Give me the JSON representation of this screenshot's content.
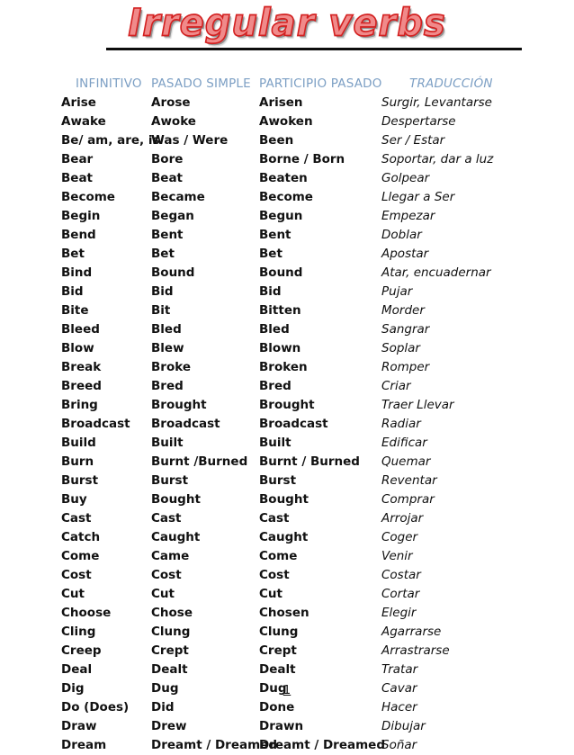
{
  "document": {
    "title": "Irregular verbs",
    "page_number": "1",
    "title_fill_color": "#F08A8A",
    "title_outline_color": "#D32020",
    "header_color": "#7C9FC4"
  },
  "table": {
    "headers": {
      "infinitive": "INFINITIVO",
      "past_simple": "PASADO SIMPLE",
      "past_participle": "PARTICIPIO PASADO",
      "translation": "TRADUCCIÓN"
    },
    "rows": [
      {
        "infinitive": "Arise",
        "past_simple": "Arose",
        "past_participle": "Arisen",
        "translation": "Surgir, Levantarse"
      },
      {
        "infinitive": "Awake",
        "past_simple": "Awoke",
        "past_participle": "Awoken",
        "translation": "Despertarse"
      },
      {
        "infinitive": "Be/ am, are, is",
        "past_simple": "Was / Were",
        "past_participle": "Been",
        "translation": "Ser / Estar"
      },
      {
        "infinitive": "Bear",
        "past_simple": "Bore",
        "past_participle": "Borne / Born",
        "translation": "Soportar, dar a luz"
      },
      {
        "infinitive": "Beat",
        "past_simple": "Beat",
        "past_participle": "Beaten",
        "translation": "Golpear"
      },
      {
        "infinitive": "Become",
        "past_simple": "Became",
        "past_participle": "Become",
        "translation": "Llegar a Ser"
      },
      {
        "infinitive": "Begin",
        "past_simple": "Began",
        "past_participle": "Begun",
        "translation": "Empezar"
      },
      {
        "infinitive": "Bend",
        "past_simple": "Bent",
        "past_participle": "Bent",
        "translation": "Doblar"
      },
      {
        "infinitive": "Bet",
        "past_simple": "Bet",
        "past_participle": "Bet",
        "translation": "Apostar"
      },
      {
        "infinitive": "Bind",
        "past_simple": "Bound",
        "past_participle": "Bound",
        "translation": "Atar, encuadernar"
      },
      {
        "infinitive": "Bid",
        "past_simple": "Bid",
        "past_participle": "Bid",
        "translation": "Pujar"
      },
      {
        "infinitive": "Bite",
        "past_simple": "Bit",
        "past_participle": "Bitten",
        "translation": "Morder"
      },
      {
        "infinitive": "Bleed",
        "past_simple": "Bled",
        "past_participle": "Bled",
        "translation": "Sangrar"
      },
      {
        "infinitive": "Blow",
        "past_simple": "Blew",
        "past_participle": "Blown",
        "translation": "Soplar"
      },
      {
        "infinitive": "Break",
        "past_simple": "Broke",
        "past_participle": "Broken",
        "translation": "Romper"
      },
      {
        "infinitive": "Breed",
        "past_simple": "Bred",
        "past_participle": "Bred",
        "translation": "Criar"
      },
      {
        "infinitive": "Bring",
        "past_simple": "Brought",
        "past_participle": "Brought",
        "translation": "Traer Llevar"
      },
      {
        "infinitive": "Broadcast",
        "past_simple": "Broadcast",
        "past_participle": "Broadcast",
        "translation": "Radiar"
      },
      {
        "infinitive": "Build",
        "past_simple": "Built",
        "past_participle": "Built",
        "translation": "Edificar"
      },
      {
        "infinitive": "Burn",
        "past_simple": "Burnt /Burned",
        "past_participle": "Burnt / Burned",
        "translation": "Quemar"
      },
      {
        "infinitive": "Burst",
        "past_simple": "Burst",
        "past_participle": "Burst",
        "translation": "Reventar"
      },
      {
        "infinitive": "Buy",
        "past_simple": "Bought",
        "past_participle": "Bought",
        "translation": "Comprar"
      },
      {
        "infinitive": "Cast",
        "past_simple": "Cast",
        "past_participle": "Cast",
        "translation": "Arrojar"
      },
      {
        "infinitive": "Catch",
        "past_simple": "Caught",
        "past_participle": "Caught",
        "translation": "Coger"
      },
      {
        "infinitive": "Come",
        "past_simple": "Came",
        "past_participle": "Come",
        "translation": "Venir"
      },
      {
        "infinitive": "Cost",
        "past_simple": "Cost",
        "past_participle": "Cost",
        "translation": "Costar"
      },
      {
        "infinitive": "Cut",
        "past_simple": "Cut",
        "past_participle": "Cut",
        "translation": "Cortar"
      },
      {
        "infinitive": "Choose",
        "past_simple": "Chose",
        "past_participle": "Chosen",
        "translation": "Elegir"
      },
      {
        "infinitive": "Cling",
        "past_simple": "Clung",
        "past_participle": "Clung",
        "translation": "Agarrarse"
      },
      {
        "infinitive": "Creep",
        "past_simple": "Crept",
        "past_participle": "Crept",
        "translation": "Arrastrarse"
      },
      {
        "infinitive": "Deal",
        "past_simple": "Dealt",
        "past_participle": "Dealt",
        "translation": "Tratar"
      },
      {
        "infinitive": "Dig",
        "past_simple": "Dug",
        "past_participle": "Dug",
        "translation": "Cavar"
      },
      {
        "infinitive": "Do (Does)",
        "past_simple": "Did",
        "past_participle": "Done",
        "translation": "Hacer"
      },
      {
        "infinitive": "Draw",
        "past_simple": "Drew",
        "past_participle": "Drawn",
        "translation": "Dibujar"
      },
      {
        "infinitive": "Dream",
        "past_simple": "Dreamt / Dreamed",
        "past_participle": "Dreamt / Dreamed",
        "translation": "Soñar"
      }
    ]
  }
}
